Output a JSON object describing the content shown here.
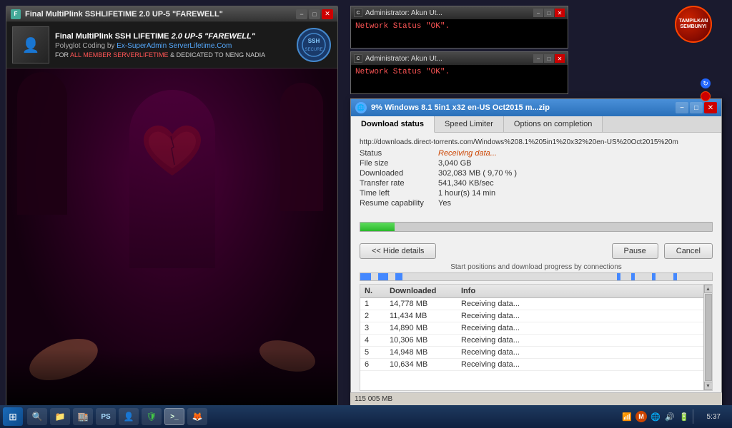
{
  "ssh_window": {
    "title": "Final MultiPlink SSHLIFETIME 2.0 UP-5 \"FAREWELL\"",
    "app_name_prefix": "Final MultiPlink SSH LIFETIME ",
    "app_name_suffix": "2.0 UP-5 \"FAREWELL\"",
    "tagline": "Polyglot Coding by ",
    "tagline_link": "Ex-SuperAdmin ServerLifetime.Com",
    "dedication_prefix": "FOR ",
    "dedication_link": "ALL MEMBER SERVERLIFETIME",
    "dedication_suffix": " & DEDICATED TO NENG NADIA",
    "min_label": "−",
    "max_label": "□",
    "close_label": "✕"
  },
  "admin_win1": {
    "title": "Administrator: Akun Ut...",
    "status": "Network Status \"OK\".",
    "min_label": "−",
    "max_label": "□",
    "close_label": "✕"
  },
  "admin_win2": {
    "title": "Administrator: Akun Ut...",
    "status": "Network Status \"OK\".",
    "min_label": "−",
    "max_label": "□",
    "close_label": "✕"
  },
  "torrent_window": {
    "title": "9% Windows 8.1 5in1 x32 en-US Oct2015 m...zip",
    "icon": "🌐",
    "url": "http://downloads.direct-torrents.com/Windows%208.1%205in1%20x32%20en-US%20Oct2015%20m",
    "min_label": "−",
    "max_label": "□",
    "close_label": "✕",
    "tabs": [
      {
        "label": "Download status",
        "active": true
      },
      {
        "label": "Speed Limiter",
        "active": false
      },
      {
        "label": "Options on completion",
        "active": false
      }
    ],
    "status_label": "Status",
    "status_value": "Receiving data...",
    "file_size_label": "File size",
    "file_size_value": "3,040  GB",
    "downloaded_label": "Downloaded",
    "downloaded_value": "302,083  MB  ( 9,70 % )",
    "transfer_rate_label": "Transfer rate",
    "transfer_rate_value": "541,340  KB/sec",
    "time_left_label": "Time left",
    "time_left_value": "1 hour(s) 14 min",
    "resume_label": "Resume capability",
    "resume_value": "Yes",
    "progress_percent": 9.7,
    "hide_details_btn": "<< Hide details",
    "pause_btn": "Pause",
    "cancel_btn": "Cancel",
    "conn_bar_label": "Start positions and download progress by connections",
    "table_headers": [
      "N.",
      "Downloaded",
      "Info"
    ],
    "connections": [
      {
        "n": "1",
        "downloaded": "14,778  MB",
        "info": "Receiving data..."
      },
      {
        "n": "2",
        "downloaded": "11,434  MB",
        "info": "Receiving data..."
      },
      {
        "n": "3",
        "downloaded": "14,890  MB",
        "info": "Receiving data..."
      },
      {
        "n": "4",
        "downloaded": "10,306  MB",
        "info": "Receiving data..."
      },
      {
        "n": "5",
        "downloaded": "14,948  MB",
        "info": "Receiving data..."
      },
      {
        "n": "6",
        "downloaded": "10,634  MB",
        "info": "Receiving data..."
      }
    ],
    "scroll_up": "▲",
    "scroll_down": "▼"
  },
  "status_bar": {
    "text": "115  005  MB"
  },
  "ts_badge": {
    "line1": "TAMPILKAN",
    "line2": "SEMBUNYI"
  },
  "taskbar": {
    "time": "5:37",
    "start_icon": "⊞",
    "icons": [
      {
        "name": "search-icon",
        "symbol": "🔍"
      },
      {
        "name": "folder-icon",
        "symbol": "📁"
      },
      {
        "name": "store-icon",
        "symbol": "🏬"
      },
      {
        "name": "powershell-icon",
        "symbol": "PS"
      },
      {
        "name": "person-icon",
        "symbol": "👤"
      },
      {
        "name": "shield-icon",
        "symbol": "🛡"
      },
      {
        "name": "terminal-icon",
        "symbol": ">_"
      },
      {
        "name": "mozilla-icon",
        "symbol": "🦊"
      }
    ],
    "tray_icons": [
      {
        "name": "modem-icon",
        "symbol": "📶"
      },
      {
        "name": "vpn-icon",
        "symbol": "M"
      },
      {
        "name": "network-icon",
        "symbol": "🌐"
      },
      {
        "name": "volume-icon",
        "symbol": "🔊"
      },
      {
        "name": "battery-icon",
        "symbol": "🔋"
      }
    ]
  }
}
